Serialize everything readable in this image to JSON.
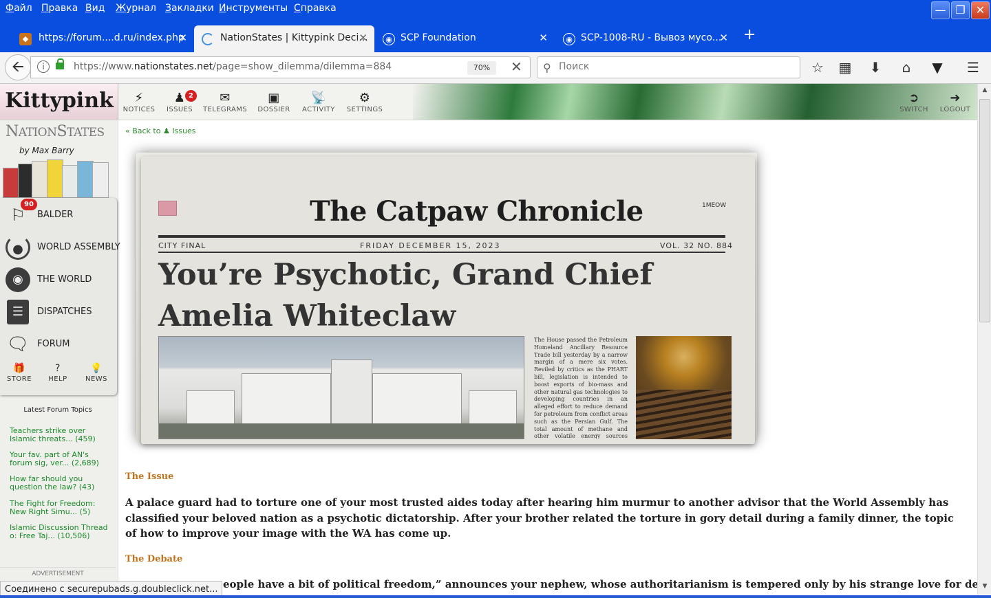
{
  "menu": [
    "Файл",
    "Правка",
    "Вид",
    "Журнал",
    "Закладки",
    "Инструменты",
    "Справка"
  ],
  "tabs": [
    {
      "title": "https://forum....d.ru/index.php",
      "icon": "forum-favicon"
    },
    {
      "title": "NationStates | Kittypink Deci...",
      "icon": "loading-spinner-icon"
    },
    {
      "title": "SCP Foundation",
      "icon": "scp-favicon"
    },
    {
      "title": "SCP-1008-RU - Вывоз мусо...",
      "icon": "scp-favicon"
    }
  ],
  "url": {
    "host_prefix": "https://www.",
    "host": "nationstates.net",
    "path": "/page=show_dilemma/dilemma=884",
    "zoom": "70%"
  },
  "search": {
    "placeholder": "Поиск"
  },
  "banner": {
    "nation": "Kittypink",
    "nav": [
      {
        "label": "NOTICES",
        "icon": "lightning-icon"
      },
      {
        "label": "ISSUES",
        "icon": "person-icon",
        "badge": "2"
      },
      {
        "label": "TELEGRAMS",
        "icon": "envelope-icon"
      },
      {
        "label": "DOSSIER",
        "icon": "book-icon"
      },
      {
        "label": "ACTIVITY",
        "icon": "satellite-icon"
      },
      {
        "label": "SETTINGS",
        "icon": "gears-icon"
      }
    ],
    "right": [
      {
        "label": "SWITCH",
        "icon": "switch-icon"
      },
      {
        "label": "LOGOUT",
        "icon": "logout-icon"
      }
    ]
  },
  "sidebar": {
    "logo_big1": "N",
    "logo_small1": "ATION",
    "logo_big2": "S",
    "logo_small2": "TATES",
    "byline": "by Max Barry",
    "items": [
      {
        "label": "BALDER",
        "icon": "flag-icon",
        "badge": "90"
      },
      {
        "label": "WORLD ASSEMBLY",
        "icon": "wreath-icon"
      },
      {
        "label": "THE WORLD",
        "icon": "globe-icon"
      },
      {
        "label": "DISPATCHES",
        "icon": "dispatch-icon"
      },
      {
        "label": "FORUM",
        "icon": "speech-bubbles-icon"
      }
    ],
    "bottom": [
      {
        "label": "STORE",
        "icon": "gift-icon"
      },
      {
        "label": "HELP",
        "icon": "question-icon"
      },
      {
        "label": "NEWS",
        "icon": "lightbulb-icon"
      }
    ],
    "forum_heading": "Latest Forum Topics",
    "forum_topics": [
      "Teachers strike over Islamic threats... (459)",
      "Your fav. part of AN's forum sig, ver... (2,689)",
      "How far should you question the law? (43)",
      "The Fight for Freedom: New Right Simu... (5)",
      "Islamic Discussion Thread o: Free Taj... (10,506)"
    ],
    "advertisement": "ADVERTISEMENT"
  },
  "main": {
    "back_prefix": "« Back to",
    "back_issues": "Issues",
    "newspaper": {
      "masthead": "The Catpaw Chronicle",
      "price": "1MEOW",
      "edition": "CITY FINAL",
      "date": "FRIDAY DECEMBER 15, 2023",
      "volume": "VOL. 32 NO. 884",
      "headline": "You’re Psychotic, Grand Chief Amelia Whiteclaw",
      "side_story": "The House passed the Petroleum Homeland Ancillary Resource Trade bill yesterday by a narrow margin of a mere six votes. Reviled by critics as the PHART bill, legislation is intended to boost exports of bio-mass and other natural gas technologies to developing countries in an alleged effort to reduce demand for petroleum from conflict areas such as the Persian Gulf. The total amount of methane and other volatile energy sources that can"
    },
    "issue_heading": "The Issue",
    "issue_text": "A palace guard had to torture one of your most trusted aides today after hearing him murmur to another advisor that the World Assembly has classified your beloved nation as a psychotic dictatorship. After your brother related the torture in gory detail during a family dinner, the topic of how to improve your image with the WA has come up.",
    "debate_heading": "The Debate",
    "debate_text": "eople have a bit of political freedom,” announces your nephew, whose authoritarianism is tempered only by his strange love for democracy."
  },
  "status": "Соединено с securepubads.g.doubleclick.net..."
}
